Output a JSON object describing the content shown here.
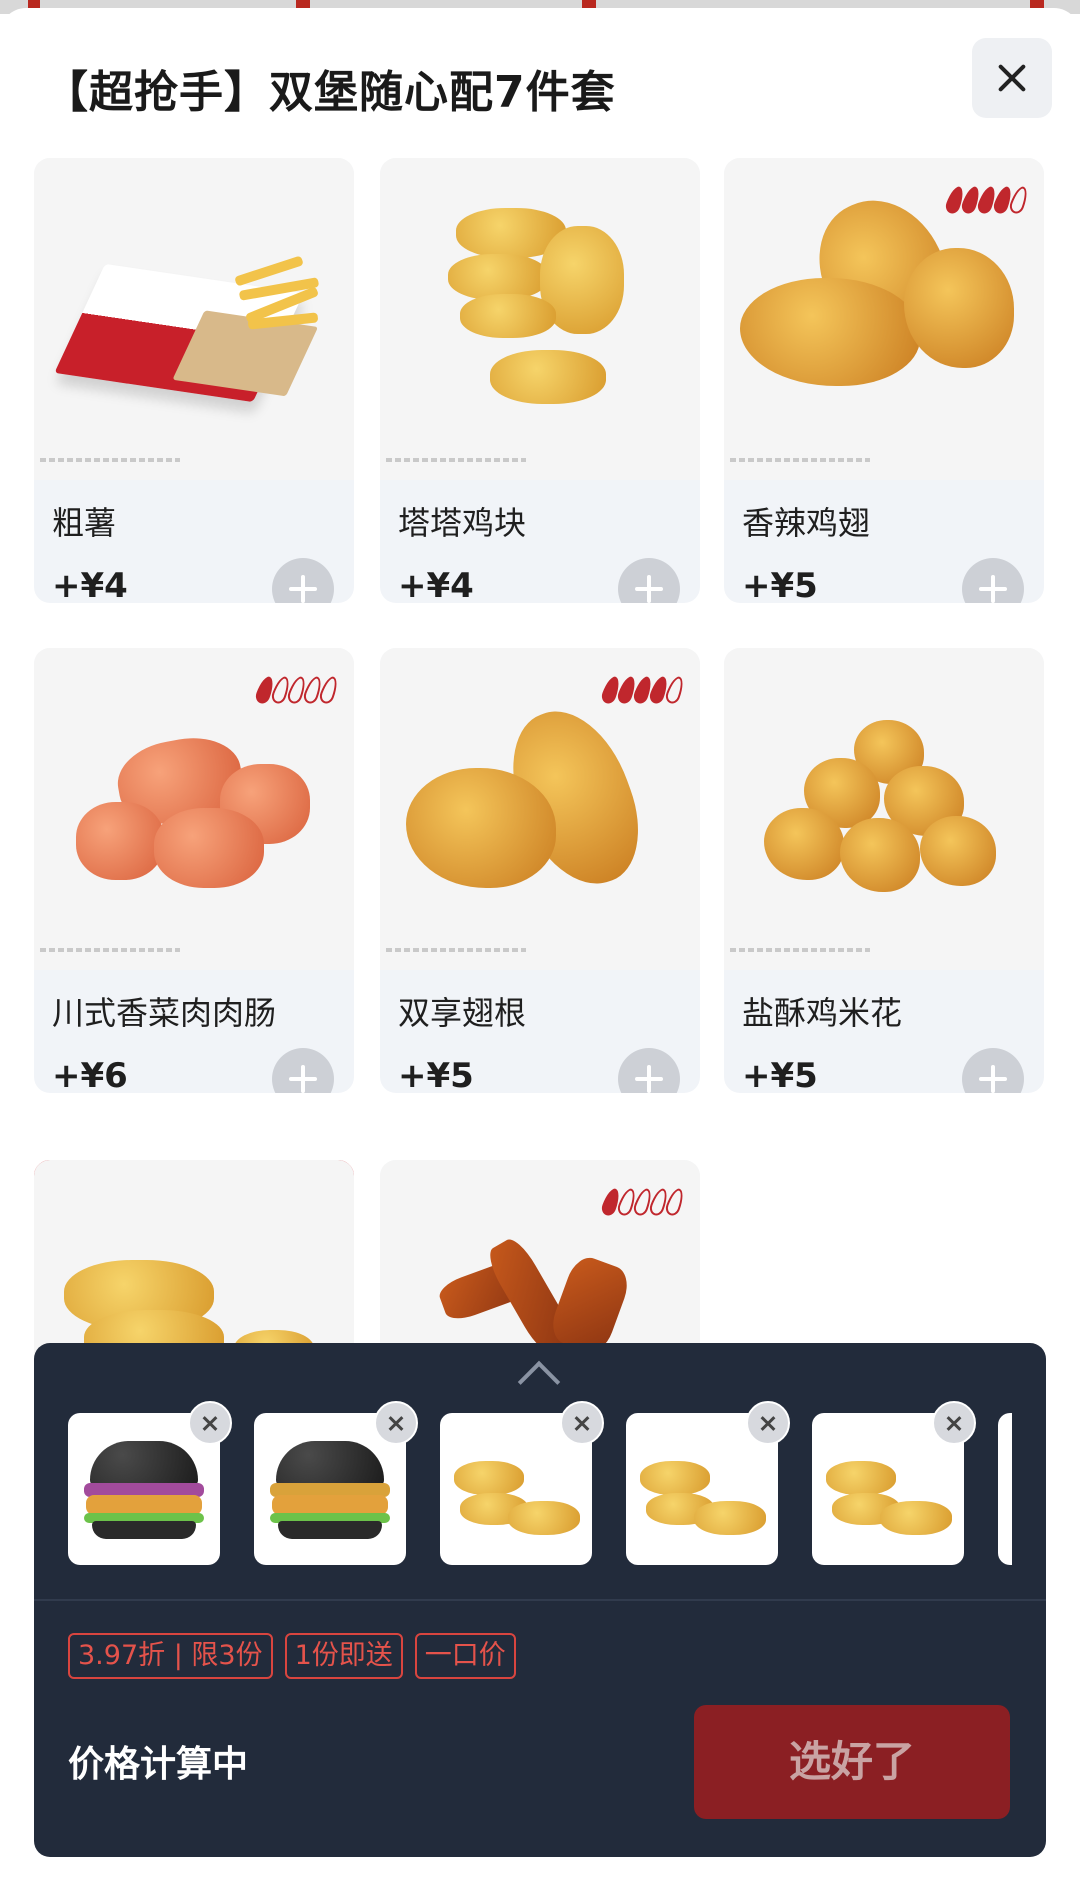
{
  "header": {
    "title": "【超抢手】双堡随心配7件套"
  },
  "products": [
    {
      "name": "粗薯",
      "price": "+¥4",
      "spice_level": 0
    },
    {
      "name": "塔塔鸡块",
      "price": "+¥4",
      "spice_level": 0
    },
    {
      "name": "香辣鸡翅",
      "price": "+¥5",
      "spice_level": 4
    },
    {
      "name": "川式香菜肉肉肠",
      "price": "+¥6",
      "spice_level": 1
    },
    {
      "name": "双享翅根",
      "price": "+¥5",
      "spice_level": 4
    },
    {
      "name": "盐酥鸡米花",
      "price": "+¥5",
      "spice_level": 0
    },
    {
      "name": "",
      "price": "",
      "spice_level": 0
    },
    {
      "name": "",
      "price": "",
      "spice_level": 1
    }
  ],
  "tray": {
    "selected_items": [
      {
        "icon": "burger-icon"
      },
      {
        "icon": "burger-icon"
      },
      {
        "icon": "nugget-icon"
      },
      {
        "icon": "nugget-icon"
      },
      {
        "icon": "nugget-icon"
      }
    ],
    "tags": [
      "3.97折 | 限3份",
      "1份即送",
      "一口价"
    ],
    "price_status": "价格计算中",
    "confirm_label": "选好了"
  },
  "colors": {
    "accent_red": "#d9353c",
    "tray_bg": "#222b3b",
    "confirm_bg": "#8b1f23",
    "card_bg": "#f1f4f8"
  }
}
